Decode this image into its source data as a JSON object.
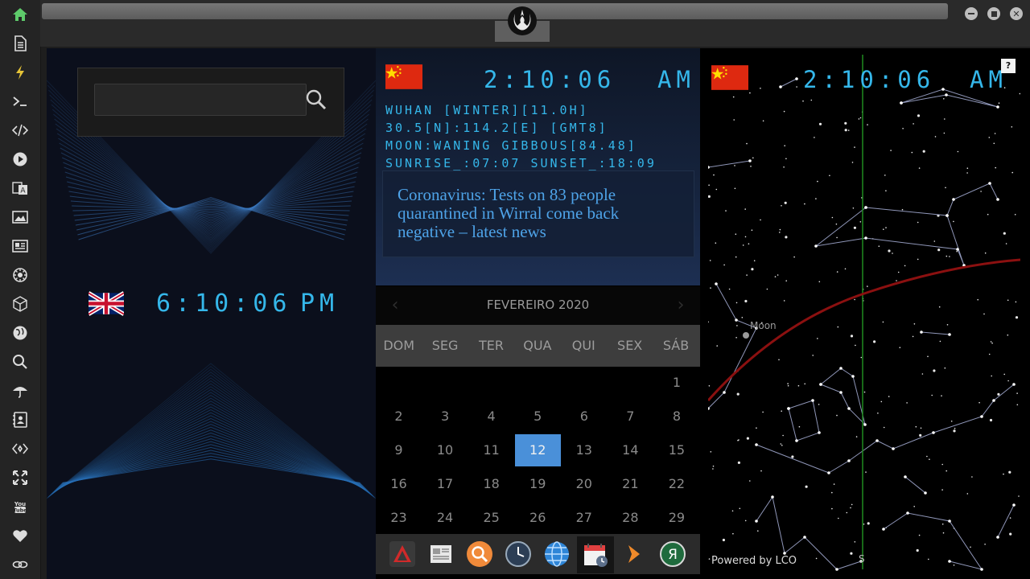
{
  "window": {
    "controls": [
      {
        "name": "minimize",
        "icon": "minus-icon"
      },
      {
        "name": "maximize",
        "icon": "square-icon"
      },
      {
        "name": "close",
        "icon": "close-icon"
      }
    ],
    "logo_icon": "rebel-alliance-icon"
  },
  "sidebar": {
    "items": [
      {
        "name": "home",
        "icon": "home-icon",
        "color": "#5ecb6b"
      },
      {
        "name": "document",
        "icon": "document-icon"
      },
      {
        "name": "power",
        "icon": "lightning-icon",
        "color": "#e5c337"
      },
      {
        "name": "terminal",
        "icon": "terminal-icon"
      },
      {
        "name": "code",
        "icon": "code-icon"
      },
      {
        "name": "play",
        "icon": "play-icon"
      },
      {
        "name": "translate",
        "icon": "translate-icon"
      },
      {
        "name": "image",
        "icon": "image-icon"
      },
      {
        "name": "news",
        "icon": "newspaper-icon"
      },
      {
        "name": "settings",
        "icon": "gear-icon"
      },
      {
        "name": "cube",
        "icon": "cube-icon"
      },
      {
        "name": "globe",
        "icon": "globe-icon"
      },
      {
        "name": "search",
        "icon": "search-icon"
      },
      {
        "name": "weather",
        "icon": "umbrella-icon"
      },
      {
        "name": "contacts",
        "icon": "contact-card-icon"
      },
      {
        "name": "transfer",
        "icon": "swap-icon"
      },
      {
        "name": "fullscreen",
        "icon": "expand-icon"
      },
      {
        "name": "youtube",
        "icon": "youtube-icon"
      },
      {
        "name": "favorites",
        "icon": "heart-icon"
      },
      {
        "name": "cloud",
        "icon": "cloud-link-icon"
      }
    ]
  },
  "left_panel": {
    "search": {
      "value": "",
      "placeholder": ""
    },
    "clock": {
      "country": "United Kingdom",
      "time": "6:10:06",
      "ampm": "PM"
    }
  },
  "wuhan_widget": {
    "time": "2:10:06",
    "ampm": "AM",
    "lines": [
      "WUHAN [WINTER][11.0H]",
      "30.5[N]:114.2[E] [GMT8]",
      "MOON:WANING GIBBOUS[84.48]",
      "SUNRISE_:07:07 SUNSET_:18:09"
    ],
    "news": "Coronavirus: Tests on 83 people quarantined in Wirral come back negative – latest news"
  },
  "calendar": {
    "month_label": "FEVEREIRO 2020",
    "prev_icon": "chevron-left-icon",
    "next_icon": "chevron-right-icon",
    "weekdays": [
      "DOM",
      "SEG",
      "TER",
      "QUA",
      "QUI",
      "SEX",
      "SÁB"
    ],
    "weeks": [
      [
        "",
        "",
        "",
        "",
        "",
        "",
        "1"
      ],
      [
        "2",
        "3",
        "4",
        "5",
        "6",
        "7",
        "8"
      ],
      [
        "9",
        "10",
        "11",
        "12",
        "13",
        "14",
        "15"
      ],
      [
        "16",
        "17",
        "18",
        "19",
        "20",
        "21",
        "22"
      ],
      [
        "23",
        "24",
        "25",
        "26",
        "27",
        "28",
        "29"
      ]
    ],
    "today": "12",
    "today_color": "#4a90d9"
  },
  "dock": {
    "items": [
      {
        "name": "launcher",
        "icon": "triangle-app-icon"
      },
      {
        "name": "news-reader",
        "icon": "newspaper-icon"
      },
      {
        "name": "search",
        "icon": "magnifier-icon"
      },
      {
        "name": "clock",
        "icon": "clock-icon"
      },
      {
        "name": "browser",
        "icon": "globe-icon"
      },
      {
        "name": "calendar",
        "icon": "calendar-icon",
        "active": true
      },
      {
        "name": "media",
        "icon": "play-arrow-icon"
      },
      {
        "name": "yandex",
        "icon": "yandex-icon"
      }
    ]
  },
  "sky_widget": {
    "time": "2:10:06",
    "ampm": "AM",
    "help_label": "?",
    "moon_label": "Moon",
    "direction_label": "S",
    "powered_by": "Powered by LCO",
    "ecliptic_color": "#8b1010",
    "meridian_color": "#1f8a1f"
  }
}
